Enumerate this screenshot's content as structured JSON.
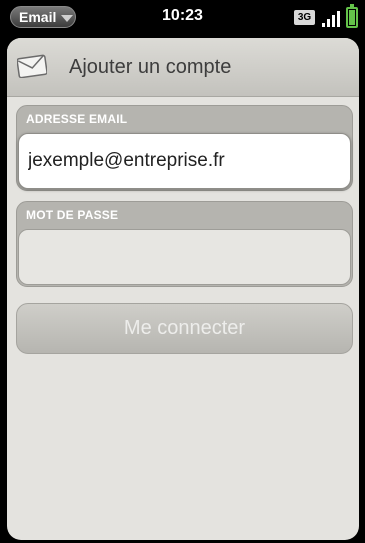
{
  "status_bar": {
    "app_menu_label": "Email",
    "time": "10:23",
    "network": "3G",
    "battery_color": "#64c34a"
  },
  "header": {
    "title": "Ajouter un compte",
    "icon": "mail-icon"
  },
  "email_group": {
    "label": "ADRESSE EMAIL",
    "value": "jexemple@entreprise.fr",
    "placeholder": ""
  },
  "password_group": {
    "label": "MOT DE PASSE",
    "value": "",
    "placeholder": ""
  },
  "connect_button": {
    "label": "Me connecter",
    "enabled": false
  },
  "colors": {
    "background": "#e4e3df",
    "group_label": "#ffffff",
    "group_bg": "#b5b4af"
  }
}
